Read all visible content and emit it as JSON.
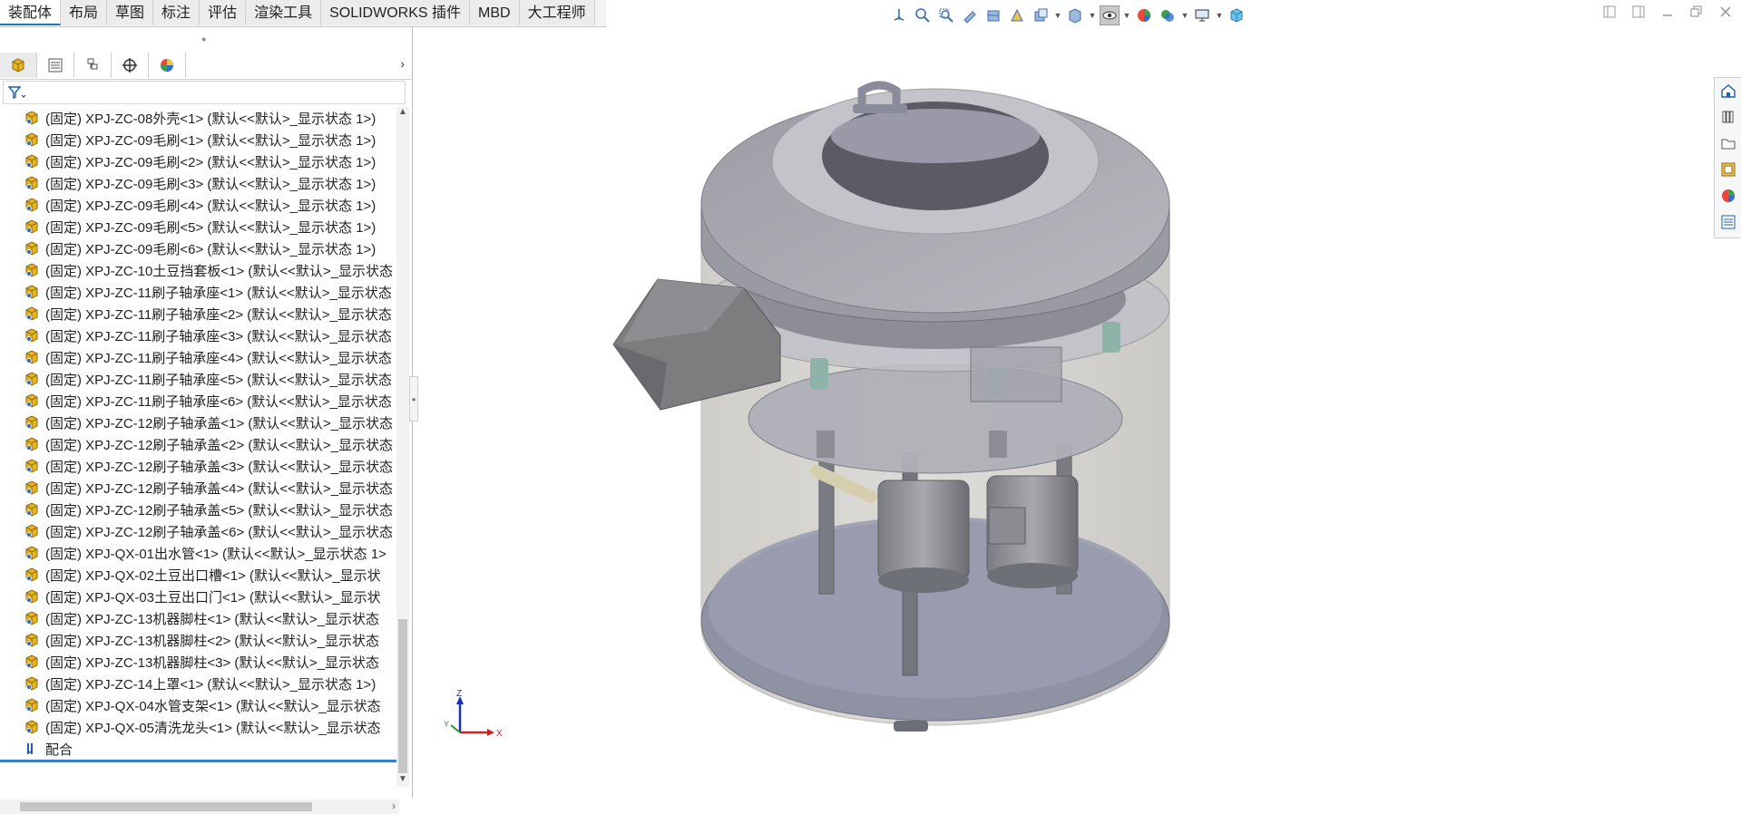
{
  "tabs": [
    {
      "label": "装配体",
      "active": true
    },
    {
      "label": "布局"
    },
    {
      "label": "草图"
    },
    {
      "label": "标注"
    },
    {
      "label": "评估"
    },
    {
      "label": "渲染工具"
    },
    {
      "label": "SOLIDWORKS 插件"
    },
    {
      "label": "MBD"
    },
    {
      "label": "大工程师"
    }
  ],
  "tree": {
    "items": [
      "(固定) XPJ-ZC-08外壳<1> (默认<<默认>_显示状态 1>)",
      "(固定) XPJ-ZC-09毛刷<1> (默认<<默认>_显示状态 1>)",
      "(固定) XPJ-ZC-09毛刷<2> (默认<<默认>_显示状态 1>)",
      "(固定) XPJ-ZC-09毛刷<3> (默认<<默认>_显示状态 1>)",
      "(固定) XPJ-ZC-09毛刷<4> (默认<<默认>_显示状态 1>)",
      "(固定) XPJ-ZC-09毛刷<5> (默认<<默认>_显示状态 1>)",
      "(固定) XPJ-ZC-09毛刷<6> (默认<<默认>_显示状态 1>)",
      "(固定) XPJ-ZC-10土豆挡套板<1> (默认<<默认>_显示状态",
      "(固定) XPJ-ZC-11刷子轴承座<1> (默认<<默认>_显示状态",
      "(固定) XPJ-ZC-11刷子轴承座<2> (默认<<默认>_显示状态",
      "(固定) XPJ-ZC-11刷子轴承座<3> (默认<<默认>_显示状态",
      "(固定) XPJ-ZC-11刷子轴承座<4> (默认<<默认>_显示状态",
      "(固定) XPJ-ZC-11刷子轴承座<5> (默认<<默认>_显示状态",
      "(固定) XPJ-ZC-11刷子轴承座<6> (默认<<默认>_显示状态",
      "(固定) XPJ-ZC-12刷子轴承盖<1> (默认<<默认>_显示状态",
      "(固定) XPJ-ZC-12刷子轴承盖<2> (默认<<默认>_显示状态",
      "(固定) XPJ-ZC-12刷子轴承盖<3> (默认<<默认>_显示状态",
      "(固定) XPJ-ZC-12刷子轴承盖<4> (默认<<默认>_显示状态",
      "(固定) XPJ-ZC-12刷子轴承盖<5> (默认<<默认>_显示状态",
      "(固定) XPJ-ZC-12刷子轴承盖<6> (默认<<默认>_显示状态",
      "(固定) XPJ-QX-01出水管<1> (默认<<默认>_显示状态 1>",
      "(固定) XPJ-QX-02土豆出口槽<1> (默认<<默认>_显示状",
      "(固定) XPJ-QX-03土豆出口门<1> (默认<<默认>_显示状",
      "(固定) XPJ-ZC-13机器脚柱<1> (默认<<默认>_显示状态",
      "(固定) XPJ-ZC-13机器脚柱<2> (默认<<默认>_显示状态",
      "(固定) XPJ-ZC-13机器脚柱<3> (默认<<默认>_显示状态",
      "(固定) XPJ-ZC-14上罩<1> (默认<<默认>_显示状态 1>)",
      "(固定) XPJ-QX-04水管支架<1> (默认<<默认>_显示状态",
      "(固定) XPJ-QX-05清洗龙头<1> (默认<<默认>_显示状态"
    ],
    "mates_label": "配合"
  },
  "triad": {
    "x": "X",
    "y": "Y",
    "z": "Z"
  },
  "colors": {
    "accent": "#1c79c8",
    "part_yellow": "#e8b51e",
    "part_blue": "#3a6fb5"
  }
}
